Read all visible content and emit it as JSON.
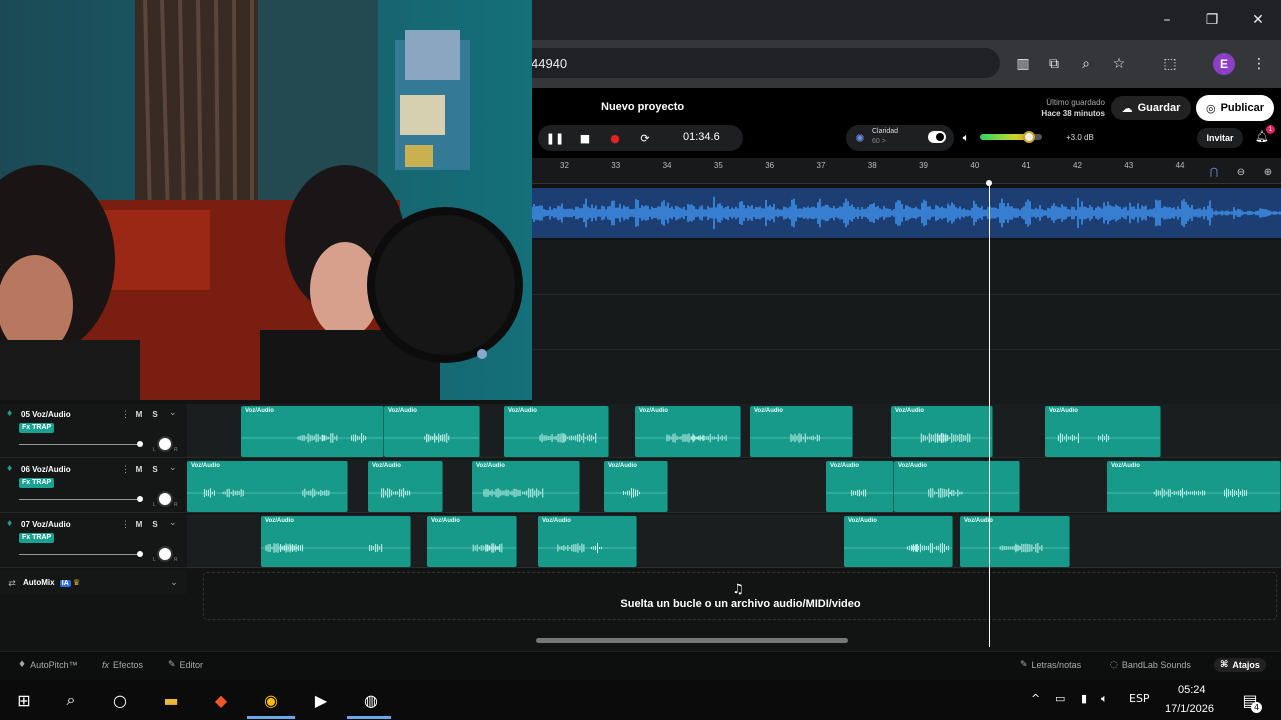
{
  "browser": {
    "url_fragment": "44940",
    "profile_initial": "E",
    "window_controls": [
      "minimize",
      "maximize",
      "close"
    ]
  },
  "daw": {
    "project_title": "Nuevo proyecto",
    "last_saved_label": "Último guardado",
    "last_saved_value": "Hace 38 minutos",
    "save_button": "Guardar",
    "publish_button": "Publicar",
    "invite_button": "Invitar",
    "notification_count": "1",
    "time": "01:34.6",
    "clarity_label": "Claridad",
    "clarity_value": "60 >",
    "volume_db": "+3.0 dB",
    "volume_level": 0.72,
    "ruler_ticks": [
      "32",
      "33",
      "34",
      "35",
      "36",
      "37",
      "38",
      "39",
      "40",
      "41",
      "42",
      "43",
      "44"
    ],
    "tracks": [
      {
        "name": "05  Voz/Audio",
        "fx": "Fx TRAP",
        "mute": "M",
        "solo": "S",
        "knob_l": "L",
        "knob_r": "R"
      },
      {
        "name": "06  Voz/Audio",
        "fx": "Fx TRAP",
        "mute": "M",
        "solo": "S",
        "knob_l": "L",
        "knob_r": "R"
      },
      {
        "name": "07  Voz/Audio",
        "fx": "Fx TRAP",
        "mute": "M",
        "solo": "S",
        "knob_l": "L",
        "knob_r": "R"
      }
    ],
    "clip_label": "Voz/Audio",
    "automix_label": "AutoMix",
    "automix_badge": "IA",
    "drop_zone_text": "Suelta un bucle o un archivo audio/MIDI/video",
    "bottom_bar": {
      "autopitch": "AutoPitch™",
      "effects": "Efectos",
      "editor": "Editor",
      "lyrics": "Letras/notas",
      "sounds": "BandLab Sounds",
      "shortcuts": "Atajos"
    }
  },
  "taskbar": {
    "language": "ESP",
    "time": "05:24",
    "date": "17/1/2026",
    "notifications": "4"
  },
  "colors": {
    "clip": "#179a8a",
    "audio_blue": "#2f7fd9",
    "accent_badge": "#1aa191"
  }
}
